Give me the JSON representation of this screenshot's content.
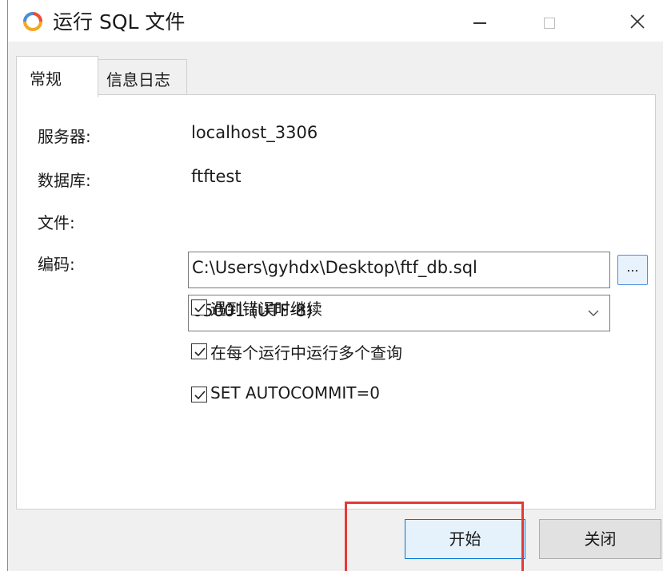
{
  "window": {
    "title": "运行 SQL 文件",
    "app_icon": "navicat-icon",
    "controls": {
      "minimize": "minimize-icon",
      "maximize": "maximize-icon",
      "close": "close-icon"
    }
  },
  "tabs": [
    {
      "label": "常规",
      "active": true
    },
    {
      "label": "信息日志",
      "active": false
    }
  ],
  "form": {
    "server_label": "服务器:",
    "server_value": "localhost_3306",
    "database_label": "数据库:",
    "database_value": "ftftest",
    "file_label": "文件:",
    "file_value": "C:\\Users\\gyhdx\\Desktop\\ftf_db.sql",
    "browse_label": "...",
    "encoding_label": "编码:",
    "encoding_value": "65001 (UTF-8)"
  },
  "options": [
    {
      "label": "遇到错误时继续",
      "checked": true
    },
    {
      "label": "在每个运行中运行多个查询",
      "checked": true
    },
    {
      "label": "SET AUTOCOMMIT=0",
      "checked": true
    }
  ],
  "buttons": {
    "start": "开始",
    "close": "关闭"
  },
  "colors": {
    "highlight": "#e53935",
    "accent": "#0078d7"
  }
}
